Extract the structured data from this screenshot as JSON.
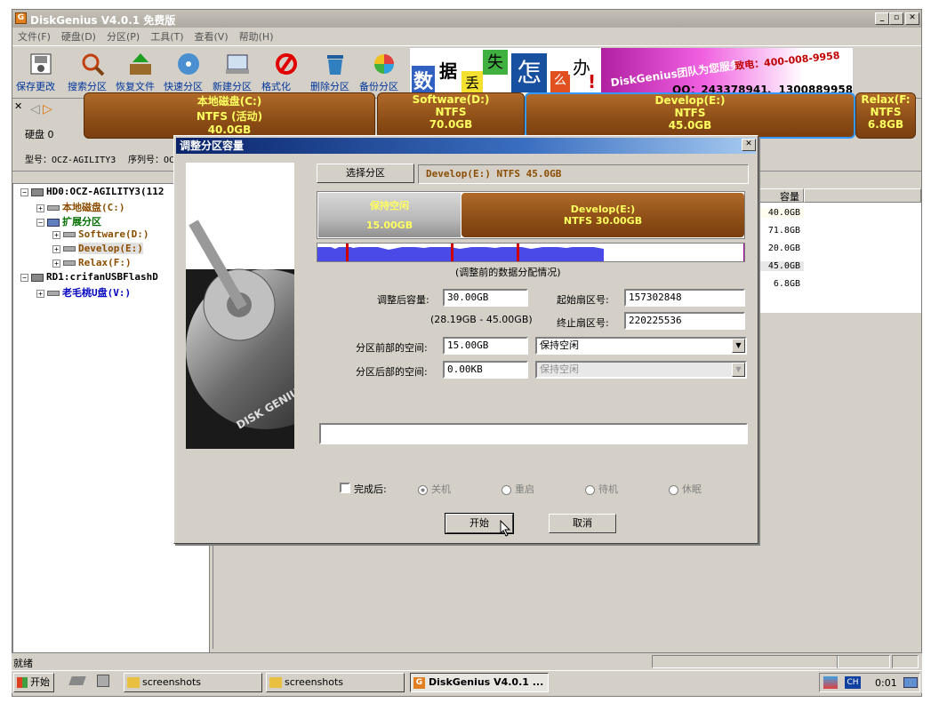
{
  "window": {
    "title": "DiskGenius V4.0.1 免费版"
  },
  "menu": [
    "文件(F)",
    "硬盘(D)",
    "分区(P)",
    "工具(T)",
    "查看(V)",
    "帮助(H)"
  ],
  "toolbar": [
    {
      "label": "保存更改",
      "icon": "save-icon"
    },
    {
      "label": "搜索分区",
      "icon": "search-icon"
    },
    {
      "label": "恢复文件",
      "icon": "recover-icon"
    },
    {
      "label": "快速分区",
      "icon": "disc-icon"
    },
    {
      "label": "新建分区",
      "icon": "new-partition-icon"
    },
    {
      "label": "格式化",
      "icon": "format-icon"
    },
    {
      "label": "删除分区",
      "icon": "trash-icon"
    },
    {
      "label": "备份分区",
      "icon": "backup-icon"
    }
  ],
  "ad": {
    "chars": [
      "数",
      "据",
      "丢",
      "失",
      "怎",
      "么",
      "办",
      "!"
    ],
    "brand": "DiskGenius团队为您服务",
    "phone": "致电：400-008-9958",
    "qq": "QQ：243378941、1300889958"
  },
  "disk": {
    "label": "硬盘 0",
    "model": "型号：OCZ-AGILITY3",
    "serial": "序列号：OC"
  },
  "partitions_bar": [
    {
      "name": "本地磁盘(C:)",
      "fs": "NTFS (活动)",
      "size": "40.0GB"
    },
    {
      "name": "Software(D:)",
      "fs": "NTFS",
      "size": "70.0GB"
    },
    {
      "name": "Develop(E:)",
      "fs": "NTFS",
      "size": "45.0GB"
    },
    {
      "name": "Relax(F:",
      "fs": "NTFS",
      "size": "6.8GB"
    }
  ],
  "tree": [
    {
      "label": "HD0:OCZ-AGILITY3(112",
      "color": "#000000"
    },
    {
      "label": "本地磁盘(C:)",
      "color": "#8c4d00"
    },
    {
      "label": "扩展分区",
      "color": "#007000"
    },
    {
      "label": "Software(D:)",
      "color": "#8c4d00"
    },
    {
      "label": "Develop(E:)",
      "color": "#8c4d00"
    },
    {
      "label": "Relax(F:)",
      "color": "#8c4d00"
    },
    {
      "label": "RD1:crifanUSBFlashD",
      "color": "#000000"
    },
    {
      "label": "老毛桃U盘(V:)",
      "color": "#0000c0"
    }
  ],
  "table": {
    "header": "容量",
    "values": [
      "40.0GB",
      "71.8GB",
      "20.0GB",
      "45.0GB",
      "6.8GB"
    ]
  },
  "status": "就绪",
  "dialog": {
    "title": "调整分区容量",
    "select_button": "选择分区",
    "selected": "Develop(E:) NTFS 45.0GB",
    "free_block": {
      "name": "保持空闲",
      "size": "15.00GB"
    },
    "part_block": {
      "name": "Develop(E:)",
      "detail": "NTFS 30.00GB"
    },
    "data_caption": "(调整前的数据分配情况)",
    "new_size_label": "调整后容量:",
    "new_size": "30.00GB",
    "range": "(28.19GB - 45.00GB)",
    "start_sector_label": "起始扇区号:",
    "start_sector": "157302848",
    "end_sector_label": "终止扇区号:",
    "end_sector": "220225536",
    "before_label": "分区前部的空间:",
    "before_value": "15.00GB",
    "before_option": "保持空闲",
    "after_label": "分区后部的空间:",
    "after_value": "0.00KB",
    "after_option": "保持空闲",
    "done_label": "完成后:",
    "options": [
      "关机",
      "重启",
      "待机",
      "休眠"
    ],
    "start_button": "开始",
    "cancel_button": "取消"
  },
  "taskbar": {
    "start": "开始",
    "items": [
      "screenshots",
      "screenshots",
      "DiskGenius V4.0.1 ..."
    ],
    "lang": "CH",
    "clock": "0:01"
  },
  "colors": {
    "partition": "#8c4d16",
    "partition_text": "#ffff60",
    "selection": "#3399ff",
    "dialog_title": "#0a246a"
  }
}
